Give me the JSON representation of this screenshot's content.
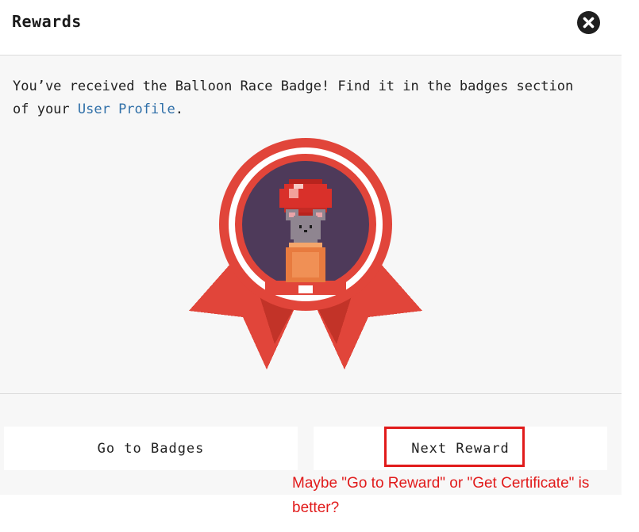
{
  "modal": {
    "title": "Rewards",
    "close_icon": "close-icon",
    "message_prefix": "You’ve received the Balloon Race Badge! Find it in the badges section of your ",
    "message_link": "User Profile",
    "message_suffix": ".",
    "badge": {
      "icon": "balloon-mouse-badge-icon",
      "colors": {
        "ribbon": "#e1453a",
        "ring": "#e1453a",
        "inner_bg": "#4e3a5a",
        "balloon": "#d9302a",
        "mouse": "#8f8590",
        "box": "#e87b3f"
      }
    },
    "buttons": {
      "go_to_badges": "Go to Badges",
      "next_reward": "Next Reward"
    }
  },
  "annotation": {
    "text": "Maybe \"Go to Reward\" or \"Get Certificate\" is better?",
    "color": "#e11b1b"
  }
}
